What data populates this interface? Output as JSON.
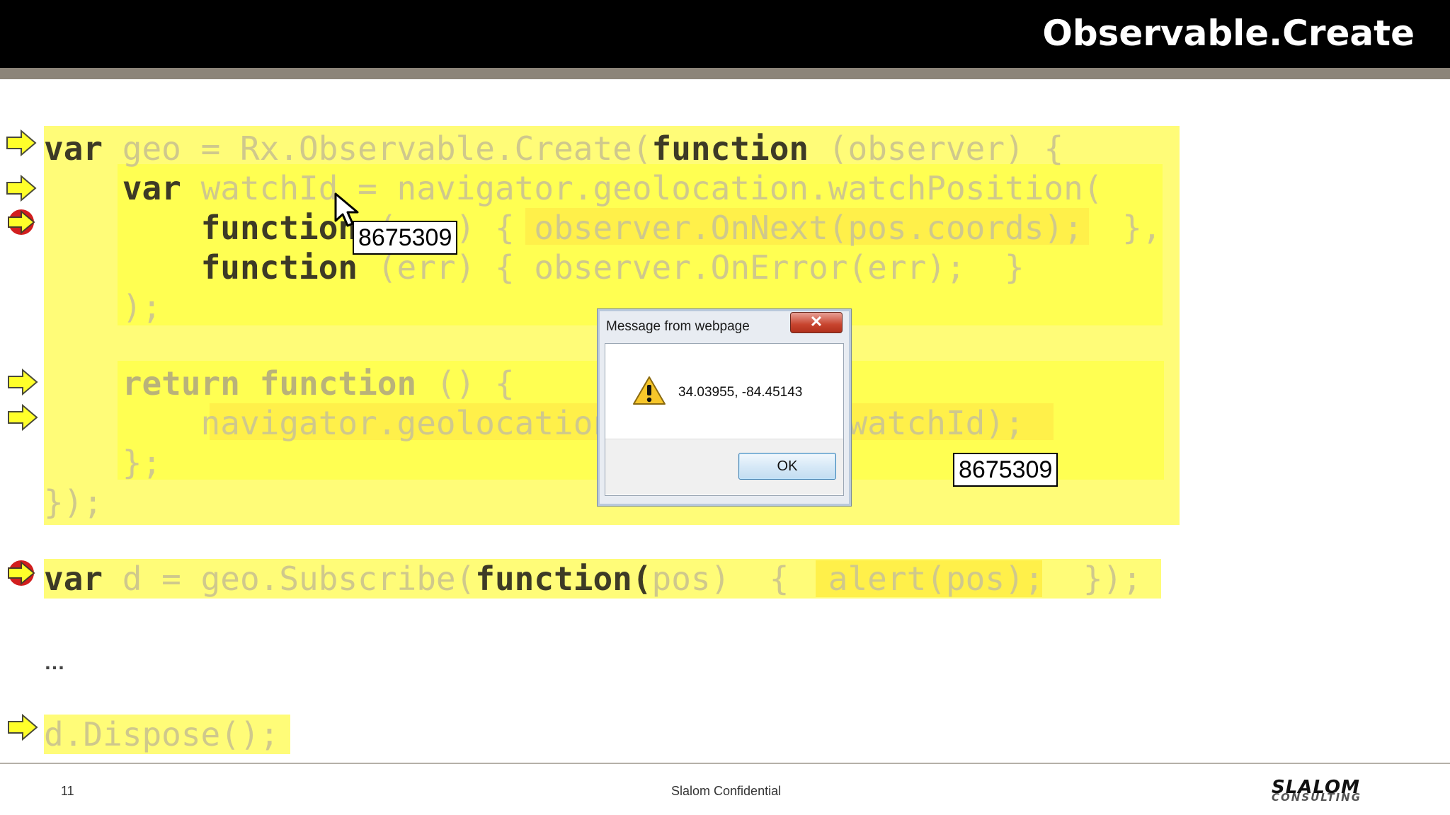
{
  "slide": {
    "title": "Observable.Create",
    "page_number": "11",
    "footer_text": "Slalom Confidential",
    "logo_text": "SLALOM",
    "logo_subtext": "CONSULTING"
  },
  "code": {
    "line1": {
      "kw": "var",
      "rest": " geo = Rx.Observable.Create(",
      "kw2": "function",
      "rest2": " (observer) {"
    },
    "line2": {
      "indent": "    ",
      "kw": "var",
      "rest": " watchId = navigator.geolocation.watchPosition("
    },
    "line3": {
      "indent": "        ",
      "kw": "function",
      "rest": " (pos) { observer.OnNext(pos.coords);  },"
    },
    "line4": {
      "indent": "        ",
      "kw": "function",
      "rest": " (err) { observer.OnError(err);  }"
    },
    "line5": "    );",
    "line6": {
      "indent": "    ",
      "kw": "return function",
      "rest": " () {"
    },
    "line7": "        navigator.geolocation.clearWatch(watchId);",
    "line8": "    };",
    "line9": "});",
    "line10": {
      "kw": "var",
      "rest": " d = geo.Subscribe(",
      "kw2": "function(",
      "rest2": "pos)  {  alert(pos);  });"
    },
    "ellipsis": "…",
    "line11": "d.Dispose();"
  },
  "callouts": {
    "watch_id_1": "8675309",
    "watch_id_2": "8675309"
  },
  "dialog": {
    "title": "Message from webpage",
    "close": "✕",
    "message": "34.03955, -84.45143",
    "ok": "OK"
  },
  "colors": {
    "highlight": "#ffff3a",
    "arrow_fill": "#ffff2a",
    "arrow_active_outline": "#d21e1e"
  }
}
